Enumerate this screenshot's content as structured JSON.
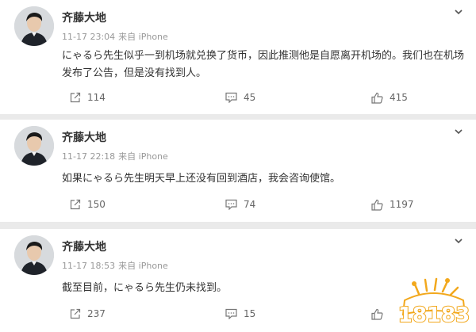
{
  "posts": [
    {
      "author": "齐藤大地",
      "time": "11-17 23:04",
      "source": "来自 iPhone",
      "text": "にゃるら先生似乎一到机场就兑换了货币，因此推测他是自愿离开机场的。我们也在机场发布了公告，但是没有找到人。",
      "shares": "114",
      "comments": "45",
      "likes": "415"
    },
    {
      "author": "齐藤大地",
      "time": "11-17 22:18",
      "source": "来自 iPhone",
      "text": "如果にゃるら先生明天早上还没有回到酒店，我会咨询使馆。",
      "shares": "150",
      "comments": "74",
      "likes": "1197"
    },
    {
      "author": "齐藤大地",
      "time": "11-17 18:53",
      "source": "来自 iPhone",
      "text": "截至目前，にゃるら先生仍未找到。",
      "shares": "237",
      "comments": "15",
      "likes": ""
    }
  ],
  "watermark": "18183",
  "icons": {
    "share": "share-icon",
    "comment": "comment-icon",
    "like": "like-icon",
    "menu": "chevron-down-icon"
  },
  "colors": {
    "background": "#eaeaea",
    "card": "#ffffff",
    "meta": "#999999",
    "watermark": "#f2a81d"
  }
}
